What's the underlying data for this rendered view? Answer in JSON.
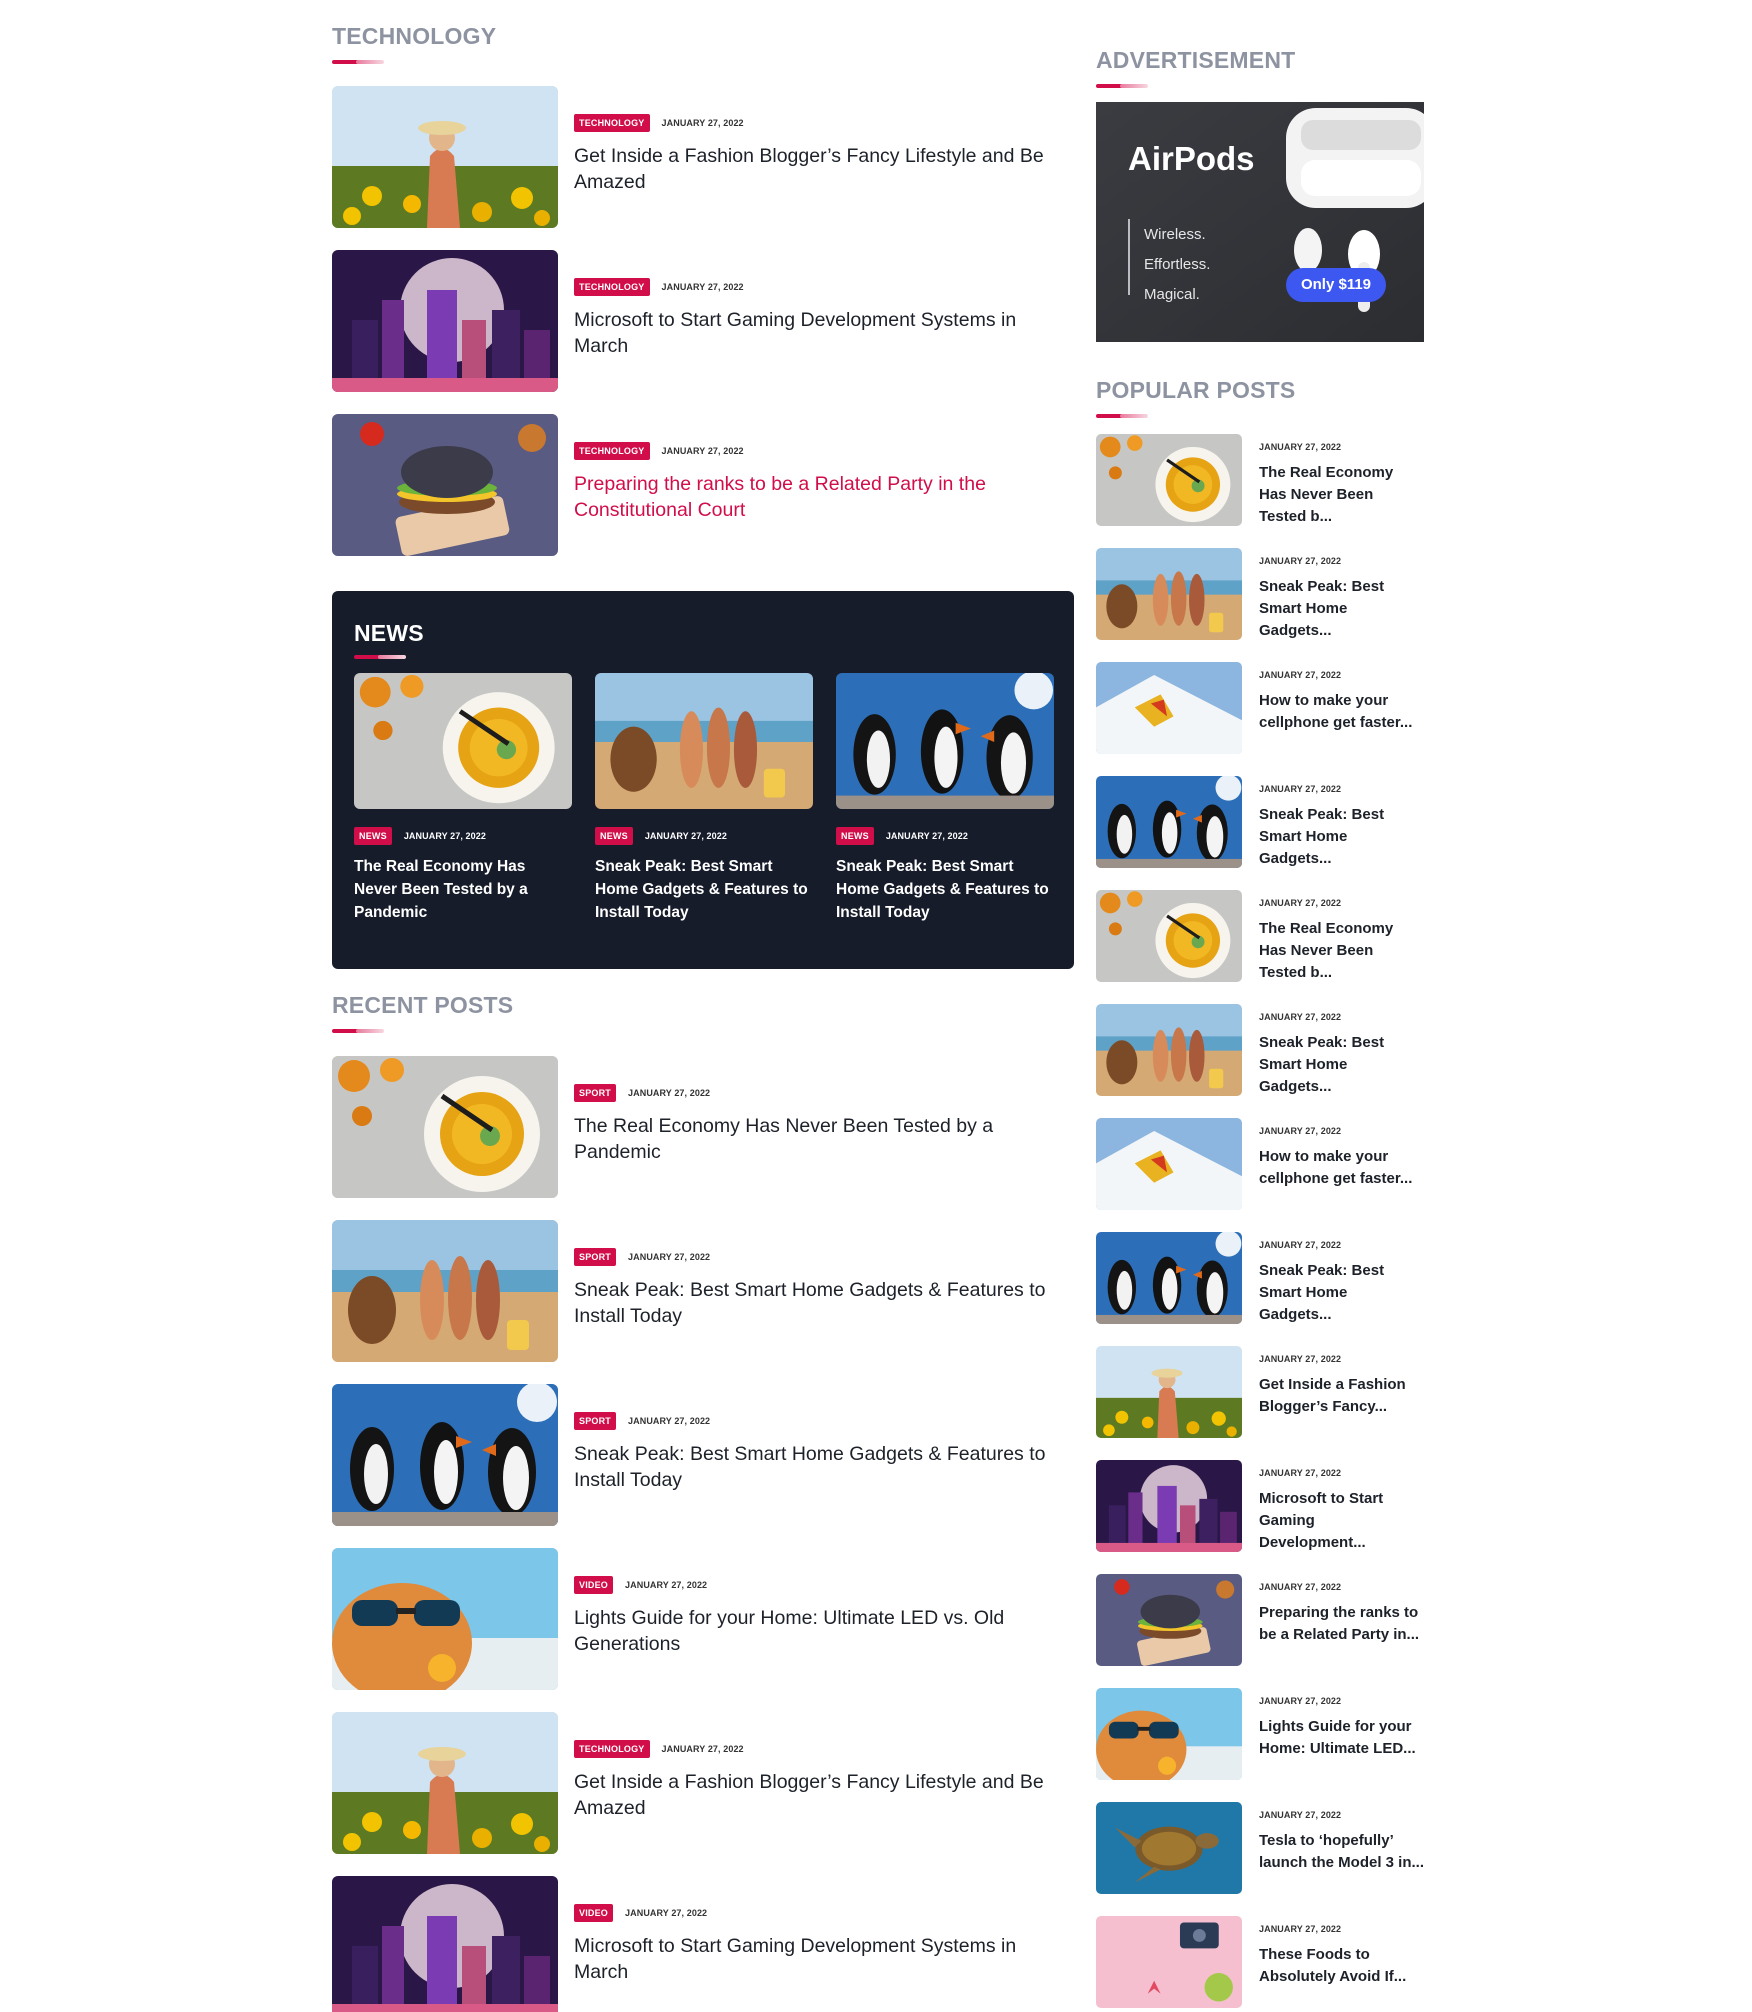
{
  "technology": {
    "title": "TECHNOLOGY",
    "posts": [
      {
        "tag": "TECHNOLOGY",
        "date": "JANUARY 27, 2022",
        "title": "Get Inside a Fashion Blogger’s Fancy Lifestyle and Be Amazed",
        "image": "sunflower-girl"
      },
      {
        "tag": "TECHNOLOGY",
        "date": "JANUARY 27, 2022",
        "title": "Microsoft to Start Gaming Development Systems in March",
        "image": "neon-city"
      },
      {
        "tag": "TECHNOLOGY",
        "date": "JANUARY 27, 2022",
        "title": "Preparing the ranks to be a Related Party in the Constitutional Court",
        "image": "burger"
      }
    ]
  },
  "news": {
    "title": "NEWS",
    "posts": [
      {
        "tag": "NEWS",
        "date": "JANUARY 27, 2022",
        "title": "The Real Economy Has Never Been Tested by a Pandemic",
        "image": "soup"
      },
      {
        "tag": "NEWS",
        "date": "JANUARY 27, 2022",
        "title": "Sneak Peak: Best Smart Home Gadgets & Features to Install Today",
        "image": "beach-dancers"
      },
      {
        "tag": "NEWS",
        "date": "JANUARY 27, 2022",
        "title": "Sneak Peak: Best Smart Home Gadgets & Features to Install Today",
        "image": "puffins"
      }
    ]
  },
  "recent": {
    "title": "RECENT POSTS",
    "posts": [
      {
        "tag": "SPORT",
        "date": "JANUARY 27, 2022",
        "title": "The Real Economy Has Never Been Tested by a Pandemic",
        "image": "soup"
      },
      {
        "tag": "SPORT",
        "date": "JANUARY 27, 2022",
        "title": "Sneak Peak: Best Smart Home Gadgets & Features to Install Today",
        "image": "beach-dancers"
      },
      {
        "tag": "SPORT",
        "date": "JANUARY 27, 2022",
        "title": "Sneak Peak: Best Smart Home Gadgets & Features to Install Today",
        "image": "puffins"
      },
      {
        "tag": "VIDEO",
        "date": "JANUARY 27, 2022",
        "title": "Lights Guide for your Home: Ultimate LED vs. Old Generations",
        "image": "cat-sunglasses"
      },
      {
        "tag": "TECHNOLOGY",
        "date": "JANUARY 27, 2022",
        "title": "Get Inside a Fashion Blogger’s Fancy Lifestyle and Be Amazed",
        "image": "sunflower-girl"
      },
      {
        "tag": "VIDEO",
        "date": "JANUARY 27, 2022",
        "title": "Microsoft to Start Gaming Development Systems in March",
        "image": "neon-city"
      }
    ]
  },
  "advertisement": {
    "title": "ADVERTISEMENT",
    "brand": "AirPods",
    "lines": [
      "Wireless.",
      "Effortless.",
      "Magical."
    ],
    "price": "Only $119"
  },
  "popular": {
    "title": "POPULAR POSTS",
    "posts": [
      {
        "date": "JANUARY 27, 2022",
        "title": "The Real Economy Has Never Been Tested b...",
        "image": "soup"
      },
      {
        "date": "JANUARY 27, 2022",
        "title": "Sneak Peak: Best Smart Home Gadgets...",
        "image": "beach-dancers"
      },
      {
        "date": "JANUARY 27, 2022",
        "title": "How to make your cellphone get faster...",
        "image": "snow-climber"
      },
      {
        "date": "JANUARY 27, 2022",
        "title": "Sneak Peak: Best Smart Home Gadgets...",
        "image": "puffins"
      },
      {
        "date": "JANUARY 27, 2022",
        "title": "The Real Economy Has Never Been Tested b...",
        "image": "soup"
      },
      {
        "date": "JANUARY 27, 2022",
        "title": "Sneak Peak: Best Smart Home Gadgets...",
        "image": "beach-dancers"
      },
      {
        "date": "JANUARY 27, 2022",
        "title": "How to make your cellphone get faster...",
        "image": "snow-climber"
      },
      {
        "date": "JANUARY 27, 2022",
        "title": "Sneak Peak: Best Smart Home Gadgets...",
        "image": "puffins"
      },
      {
        "date": "JANUARY 27, 2022",
        "title": "Get Inside a Fashion Blogger’s Fancy...",
        "image": "sunflower-girl"
      },
      {
        "date": "JANUARY 27, 2022",
        "title": "Microsoft to Start Gaming Development...",
        "image": "neon-city"
      },
      {
        "date": "JANUARY 27, 2022",
        "title": "Preparing the ranks to be a Related Party in...",
        "image": "burger"
      },
      {
        "date": "JANUARY 27, 2022",
        "title": "Lights Guide for your Home: Ultimate LED...",
        "image": "cat-sunglasses"
      },
      {
        "date": "JANUARY 27, 2022",
        "title": "Tesla to ‘hopefully’ launch the Model 3 in...",
        "image": "sea-turtle"
      },
      {
        "date": "JANUARY 27, 2022",
        "title": "These Foods to Absolutely Avoid If...",
        "image": "pink-flatlay"
      }
    ]
  },
  "colors": {
    "accent": "#d10d4a",
    "heading": "#8d93a0",
    "dark_panel": "#171c2b",
    "ad_button": "#3d58f0"
  }
}
